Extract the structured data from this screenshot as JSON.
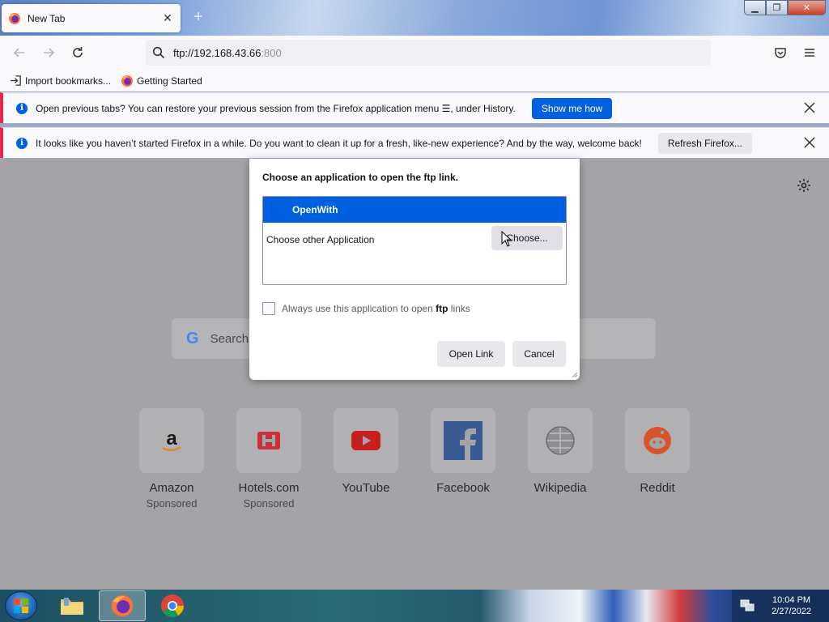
{
  "tab": {
    "title": "New Tab",
    "close_glyph": "✕"
  },
  "new_tab_glyph": "+",
  "window_controls": {
    "minimize": "▁",
    "maximize": "❐",
    "close": "✕"
  },
  "urlbar": {
    "host": "ftp://192.168.43.66",
    "port": ":800"
  },
  "bookmarks": [
    {
      "label": "Import bookmarks...",
      "icon": "import-icon"
    },
    {
      "label": "Getting Started",
      "icon": "firefox-icon"
    }
  ],
  "notifications": [
    {
      "message": "Open previous tabs? You can restore your previous session from the Firefox application menu ☰, under History.",
      "button": "Show me how"
    },
    {
      "message": "It looks like you haven’t started Firefox in a while. Do you want to clean it up for a fresh, like-new experience? And by the way, welcome back!",
      "button": "Refresh Firefox..."
    }
  ],
  "search": {
    "logo": "G",
    "placeholder": "Search"
  },
  "top_sites": [
    {
      "name": "Amazon",
      "sub": "Sponsored",
      "icon": "amazon-icon"
    },
    {
      "name": "Hotels.com",
      "sub": "Sponsored",
      "icon": "hotels-icon"
    },
    {
      "name": "YouTube",
      "sub": "",
      "icon": "youtube-icon"
    },
    {
      "name": "Facebook",
      "sub": "",
      "icon": "facebook-icon"
    },
    {
      "name": "Wikipedia",
      "sub": "",
      "icon": "wikipedia-icon"
    },
    {
      "name": "Reddit",
      "sub": "",
      "icon": "reddit-icon"
    }
  ],
  "dialog": {
    "title": "Choose an application to open the ftp link.",
    "selected_app": "OpenWith",
    "other_label": "Choose other Application",
    "choose_button": "Choose...",
    "always_prefix": "Always use this application to open ",
    "always_bold": "ftp",
    "always_suffix": " links",
    "always_checked": false,
    "open_button": "Open Link",
    "cancel_button": "Cancel"
  },
  "taskbar": {
    "time": "10:04 PM",
    "date": "2/27/2022"
  },
  "colors": {
    "accent": "#0060df",
    "notification_border": "#e22850"
  }
}
